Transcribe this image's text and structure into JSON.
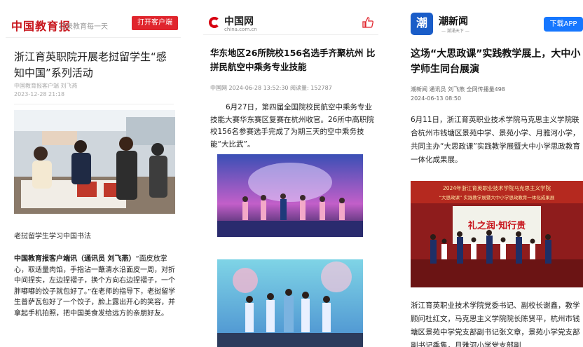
{
  "panel1": {
    "logo": "中国教育报",
    "slogan": "记录教育每一天",
    "open_button": "打开客户端",
    "title": "浙江育英职院开展老挝留学生“感知中国”系列活动",
    "source_line": "中国教育报客户端   刘飞燕",
    "datetime": "2023-12-28 21:18",
    "photo_caption": "老挝留学生学习中国书法",
    "body_lead": "中国教育报客户端讯（通讯员    刘飞燕）",
    "body_text": "“面皮放掌心，取适量肉馅，手指沾一蘸清水沿面皮一周，对折中间捏实，左边捏褶子，换个方向右边捏褶子，一个胖嘟嘟的饺子就包好了。”在老师的指导下，老挝留学生普萨瓦包好了一个饺子，脸上露出开心的笑容，并拿起手机拍照，把中国美食发给远方的亲朋好友。"
  },
  "panel2": {
    "logo": "中国网",
    "logo_sub": "china.com.cn",
    "title": "华东地区26所院校156名选手齐聚杭州 比拼民航空中乘务专业技能",
    "meta": "中国网 2024-06-28 13:52:30     阅读量: 152787",
    "body": "6月27日，第四届全国院校民航空中乘务专业技能大赛华东赛区复赛在杭州收官。26所中高职院校156名参赛选手完成了为期三天的空中乘务技能“大比武”。"
  },
  "panel3": {
    "logo_box": "潮",
    "logo": "潮新闻",
    "logo_sub": "— 潮涌天下 —",
    "download_button": "下载APP",
    "title": "这场“大思政课”实践教学展上，大中小学师生同台展演",
    "meta_line1": "潮新闻 通讯员 刘飞燕 全网传播量498",
    "meta_line2": "2024-06-13 08:50",
    "body": "6月11日，浙江育英职业技术学院马克思主义学院联合杭州市钱塘区景苑中学、景苑小学、月雅河小学，共同主办“大思政课”实践教学展暨大中小学思政教育一体化成果展。",
    "banner_line1": "2024年浙江育英职业技术学院马克思主义学院",
    "banner_line2": "“大思政课” 实践教学展暨大中小学思政教育一体化成果展",
    "screen_text": "礼之润·知行贵",
    "body2": "浙江育英职业技术学院党委书记、副校长谢鑫，教学顾问杜红文，马克思主义学院院长陈贤平，杭州市钱塘区景苑中学党支部副书记张文章，景苑小学党支部副书记季隽，月雅河小学党支部副"
  },
  "colors": {
    "jyb_red": "#e0252d",
    "china_red": "#d7000f",
    "chao_blue": "#1677ff"
  }
}
